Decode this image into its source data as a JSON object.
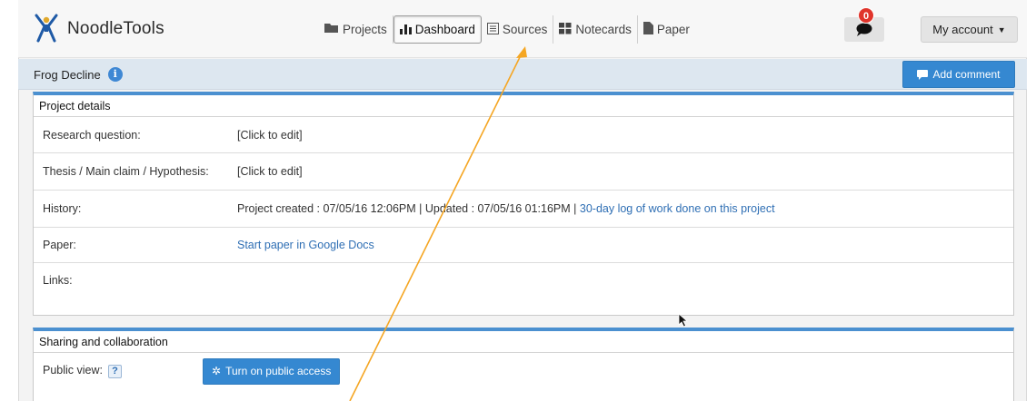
{
  "app": {
    "name": "NoodleTools"
  },
  "nav": {
    "items": [
      {
        "label": "Projects",
        "icon": "folder-icon"
      },
      {
        "label": "Dashboard",
        "icon": "bar-chart-icon",
        "active": true
      },
      {
        "label": "Sources",
        "icon": "list-icon"
      },
      {
        "label": "Notecards",
        "icon": "grid-icon"
      },
      {
        "label": "Paper",
        "icon": "document-icon"
      }
    ]
  },
  "header": {
    "comment_count": "0",
    "account_label": "My account"
  },
  "project": {
    "title": "Frog Decline",
    "add_comment_label": "Add comment"
  },
  "details": {
    "heading": "Project details",
    "rows": [
      {
        "label": "Research question:",
        "value": "[Click to edit]"
      },
      {
        "label": "Thesis / Main claim / Hypothesis:",
        "value": "[Click to edit]"
      },
      {
        "label": "History:",
        "value": "Project created : 07/05/16 12:06PM | Updated : 07/05/16 01:16PM | ",
        "link": "30-day log of work done on this project"
      },
      {
        "label": "Paper:",
        "link": "Start paper in Google Docs"
      },
      {
        "label": "Links:",
        "value": ""
      }
    ]
  },
  "sharing": {
    "heading": "Sharing and collaboration",
    "public_view_label": "Public view:",
    "help_label": "?",
    "public_button_label": "Turn on public access"
  },
  "colors": {
    "accent": "#3588d1",
    "panel_top": "#4b90d0",
    "subbar": "#dde7f0",
    "badge": "#e0342b",
    "annotation_arrow": "#f5a623"
  }
}
